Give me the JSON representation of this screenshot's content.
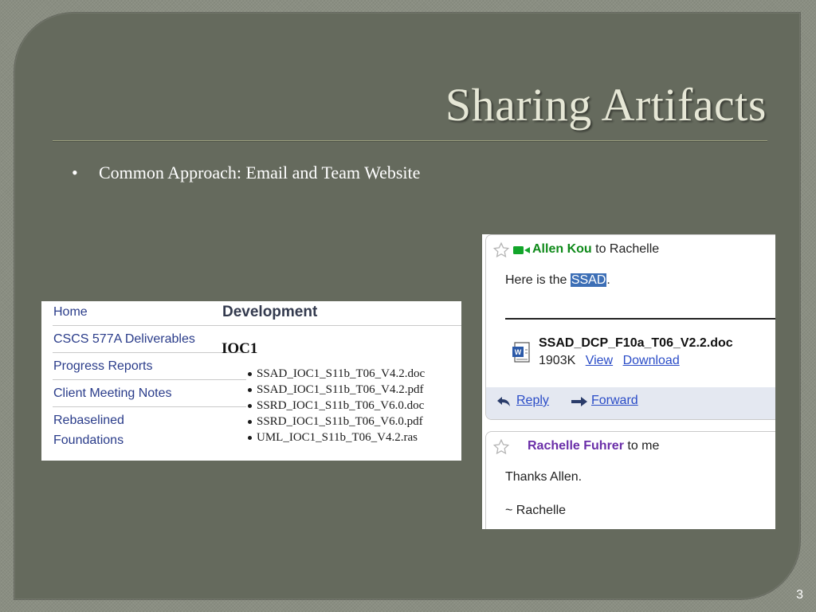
{
  "slide": {
    "title": "Sharing Artifacts",
    "bullet_marker": "•",
    "bullet": "Common Approach: Email and Team Website",
    "page_number": "3"
  },
  "website": {
    "nav": [
      {
        "label": "Home"
      },
      {
        "label": "CSCS 577A Deliverables"
      },
      {
        "label": "Progress Reports"
      },
      {
        "label": "Client Meeting Notes"
      },
      {
        "label": "Rebaselined"
      },
      {
        "label": "Foundations"
      }
    ],
    "section_title": "Development",
    "subsection_title": "IOC1",
    "files": [
      "SSAD_IOC1_S11b_T06_V4.2.doc",
      "SSAD_IOC1_S11b_T06_V4.2.pdf",
      "SSRD_IOC1_S11b_T06_V6.0.doc",
      "SSRD_IOC1_S11b_T06_V6.0.pdf",
      "UML_IOC1_S11b_T06_V4.2.ras"
    ]
  },
  "email": {
    "message1": {
      "sender": "Allen Kou",
      "recipient_text": " to Rachelle",
      "body_prefix": "Here is the ",
      "body_highlight": "SSAD",
      "body_suffix": ".",
      "attachment_name": "SSAD_DCP_F10a_T06_V2.2.doc",
      "attachment_size": "1903K",
      "view_label": "View",
      "download_label": "Download",
      "reply_label": "Reply",
      "forward_label": "Forward"
    },
    "message2": {
      "sender": "Rachelle Fuhrer",
      "recipient_text": " to me",
      "body_line1": "Thanks Allen.",
      "body_line2": "~ Rachelle"
    }
  },
  "colors": {
    "background": "#8a8e82",
    "slide_panel": "#656a5d",
    "title_text": "#e6e7d6",
    "link_blue": "#2a4cc7",
    "sender1_green": "#0f8a1a",
    "sender2_purple": "#6a2ea8",
    "highlight": "#3d6fb6"
  }
}
